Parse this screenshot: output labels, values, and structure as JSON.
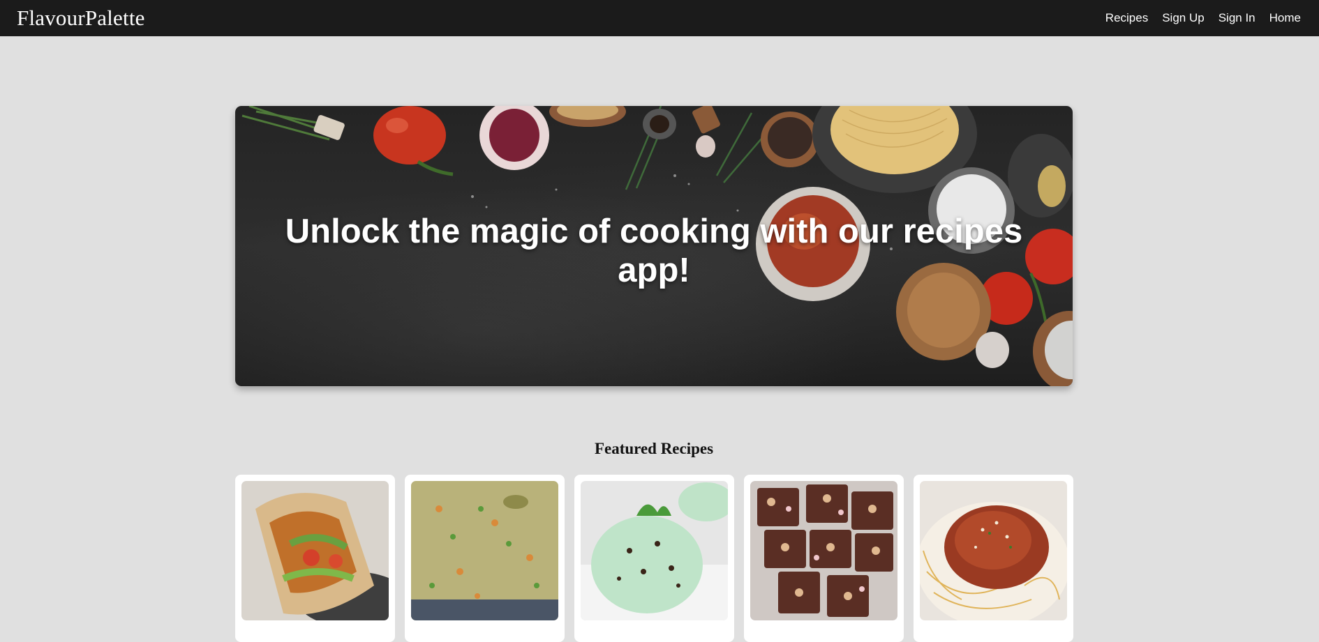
{
  "navbar": {
    "brand": "FlavourPalette",
    "links": [
      "Recipes",
      "Sign Up",
      "Sign In",
      "Home"
    ]
  },
  "hero": {
    "title": "Unlock the magic of cooking with our recipes app!"
  },
  "featured": {
    "heading": "Featured Recipes",
    "cards": [
      {
        "image": "chicken-wrap-photo"
      },
      {
        "image": "vegetable-fried-rice-photo"
      },
      {
        "image": "mint-chocolate-chip-ice-cream-photo"
      },
      {
        "image": "rocky-road-fudge-photo"
      },
      {
        "image": "spaghetti-bolognese-photo"
      }
    ]
  }
}
